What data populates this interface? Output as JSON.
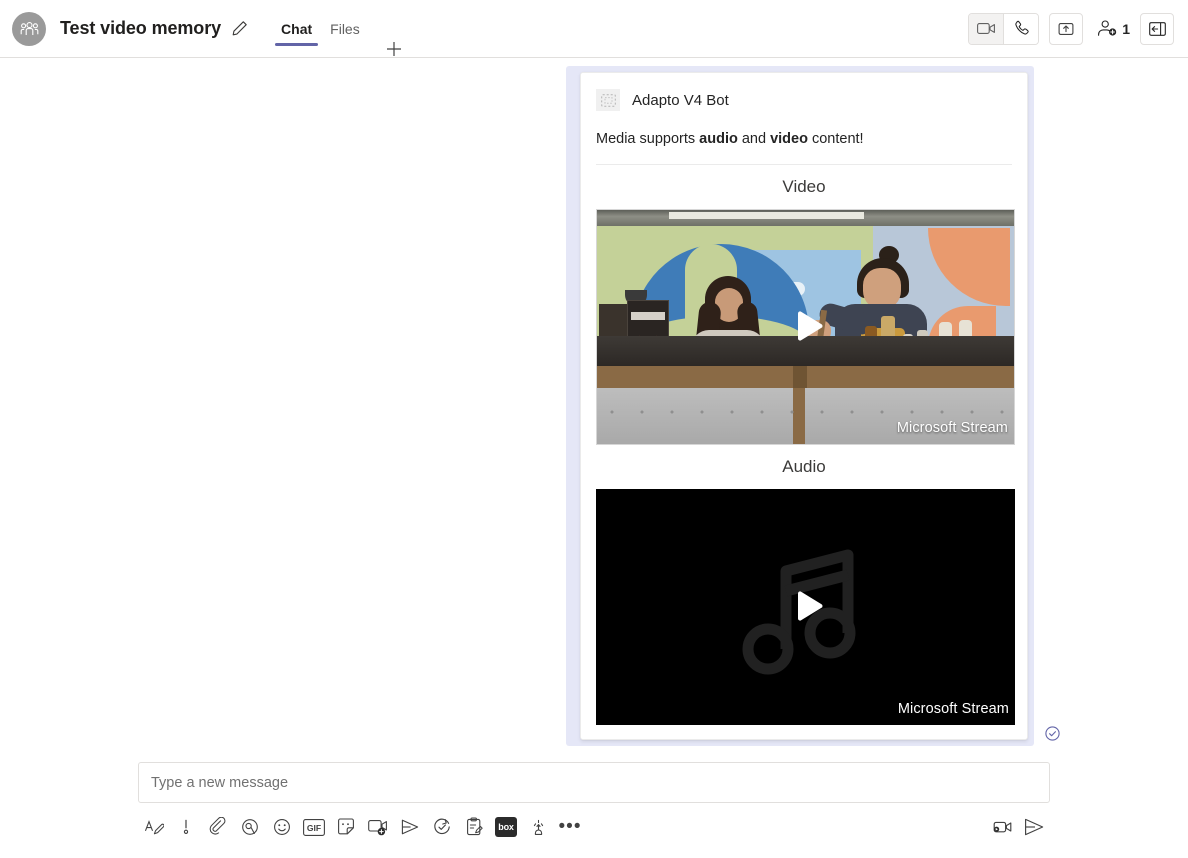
{
  "header": {
    "avatar_icon": "people-group-icon",
    "title": "Test video memory",
    "edit_icon": "pencil-icon",
    "tabs": [
      {
        "label": "Chat",
        "active": true
      },
      {
        "label": "Files",
        "active": false
      }
    ],
    "add_tab_icon": "plus-icon",
    "actions": {
      "video_call_icon": "video-camera-icon",
      "audio_call_icon": "phone-icon",
      "share_icon": "share-screen-icon",
      "add_people_icon": "add-person-icon",
      "people_count": "1",
      "open_panel_icon": "open-side-panel-icon"
    }
  },
  "message": {
    "bot_avatar_icon": "broken-image-placeholder-icon",
    "bot_name": "Adapto V4 Bot",
    "intro_prefix": "Media supports ",
    "intro_bold_1": "audio",
    "intro_middle": " and ",
    "intro_bold_2": "video",
    "intro_suffix": " content!",
    "sections": [
      {
        "title": "Video",
        "kind": "video",
        "provider_label": "Microsoft Stream",
        "play_icon": "play-icon"
      },
      {
        "title": "Audio",
        "kind": "audio",
        "provider_label": "Microsoft Stream",
        "play_icon": "play-icon",
        "placeholder_icon": "music-note-icon"
      }
    ],
    "sent_status_icon": "sent-check-circle-icon",
    "highlight_color": "#e5e7f7"
  },
  "composer": {
    "placeholder": "Type a new message",
    "value": "",
    "tools": [
      {
        "name": "format-icon",
        "glyph": "format"
      },
      {
        "name": "urgent-icon",
        "glyph": "urgent"
      },
      {
        "name": "attach-icon",
        "glyph": "attach"
      },
      {
        "name": "loop-component-icon",
        "glyph": "loop"
      },
      {
        "name": "emoji-icon",
        "glyph": "emoji"
      },
      {
        "name": "giphy-icon",
        "glyph": "gif",
        "label": "GIF"
      },
      {
        "name": "sticker-icon",
        "glyph": "sticker"
      },
      {
        "name": "meet-now-icon",
        "glyph": "meetnow"
      },
      {
        "name": "stream-icon",
        "glyph": "stream"
      },
      {
        "name": "praise-icon",
        "glyph": "approvals"
      },
      {
        "name": "forms-icon",
        "glyph": "forms"
      },
      {
        "name": "box-app-icon",
        "glyph": "box",
        "label": "box"
      },
      {
        "name": "praise-hand-icon",
        "glyph": "praisehand"
      },
      {
        "name": "more-options-icon",
        "glyph": "more"
      }
    ],
    "right_tools": [
      {
        "name": "video-clip-icon",
        "glyph": "videoclip"
      },
      {
        "name": "send-icon",
        "glyph": "send"
      }
    ]
  },
  "theme": {
    "brand_purple": "#6264a7",
    "border_gray": "#e1dfdd",
    "text_dark": "#242424",
    "text_muted": "#616161"
  }
}
